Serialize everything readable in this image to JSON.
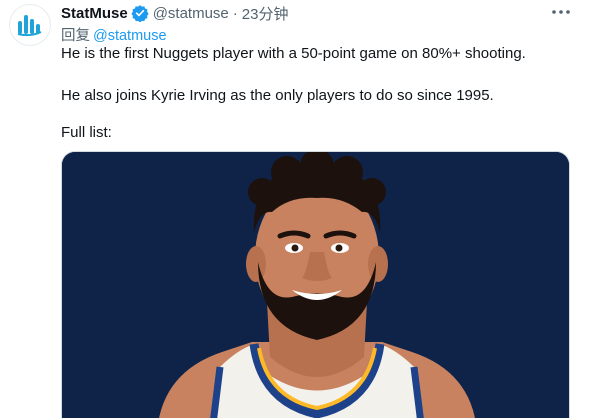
{
  "author": {
    "name": "StatMuse",
    "handle": "@statmuse",
    "separator": "·",
    "time": "23分钟",
    "verified_icon": "verified-badge-icon",
    "avatar_icon": "statmuse-logo-icon"
  },
  "reply": {
    "prefix": "回复",
    "mention": "@statmuse"
  },
  "body": {
    "line1": "He is the first Nuggets player with a 50-point game on 80%+ shooting.",
    "line2": "He also joins Kyrie Irving as the only players to do so since 1995.",
    "line3": "Full list:"
  },
  "media": {
    "description_icon": "player-illustration",
    "background_color": "#0f2348"
  },
  "colors": {
    "accent": "#1d9bf0",
    "secondary_text": "#536471",
    "primary_text": "#0f1419"
  },
  "more_icon": "more-horizontal-icon"
}
